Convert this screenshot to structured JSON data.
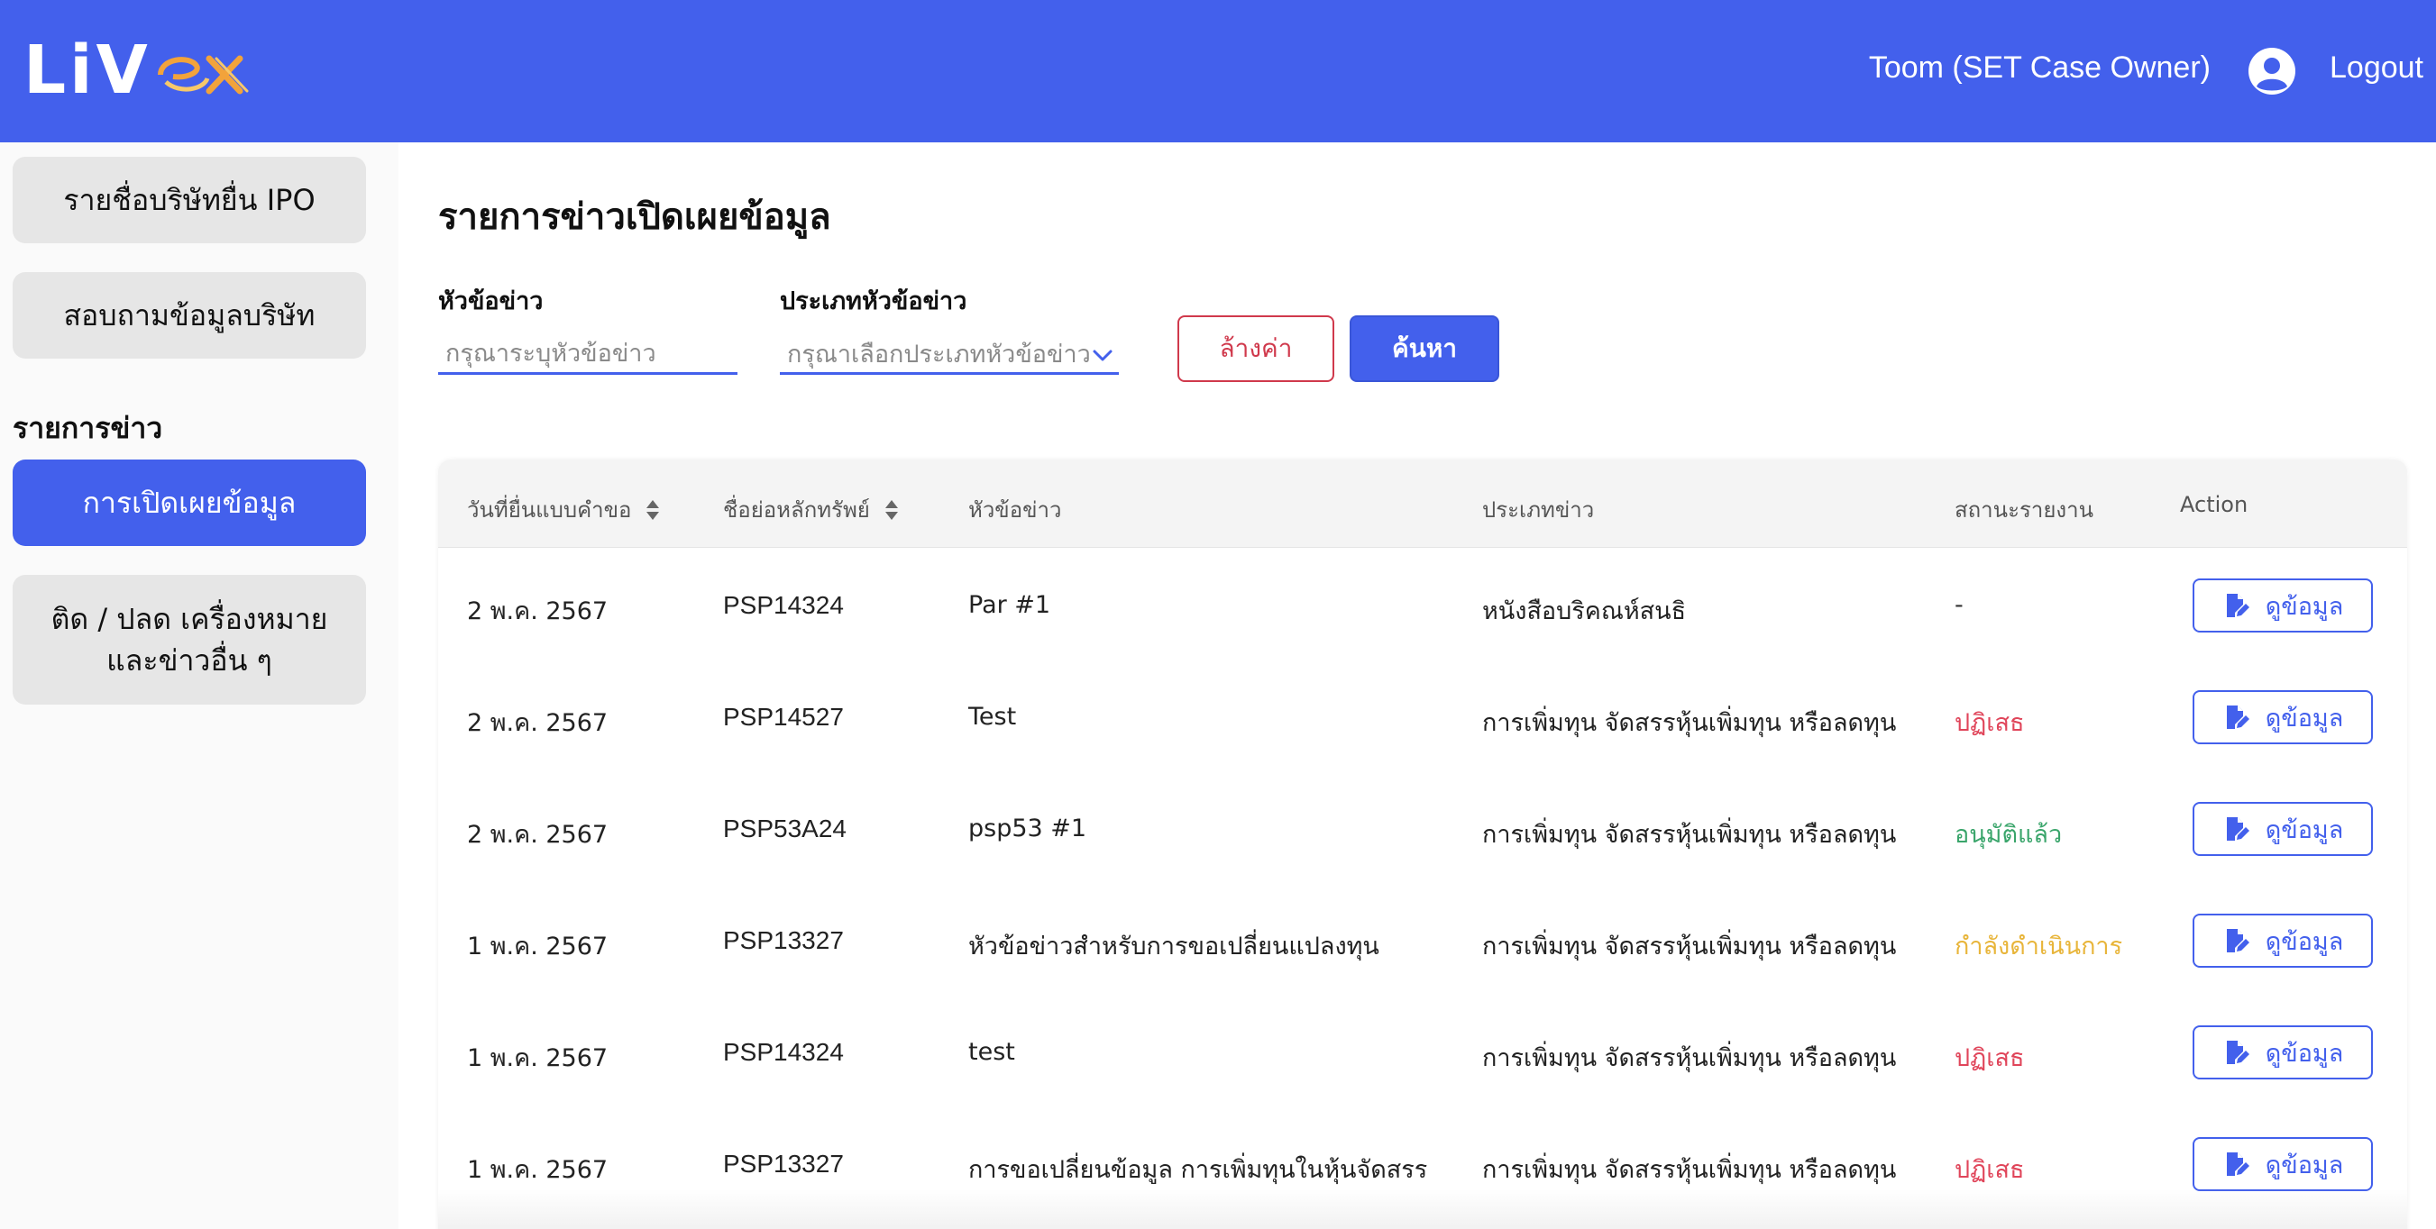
{
  "header": {
    "logo_text": "LiV",
    "user_name": "Toom (SET Case Owner)",
    "logout_label": "Logout",
    "brand_color": "#4360ec"
  },
  "sidebar": {
    "items": [
      {
        "label": "รายชื่อบริษัทยื่น IPO"
      },
      {
        "label": "สอบถามข้อมูลบริษัท"
      }
    ],
    "section_title": "รายการข่าว",
    "section_items": [
      {
        "label": "การเปิดเผยข้อมูล",
        "active": true
      },
      {
        "label": "ติด / ปลด เครื่องหมายและข่าวอื่น ๆ",
        "active": false
      }
    ]
  },
  "main": {
    "title": "รายการข่าวเปิดเผยข้อมูล",
    "filters": {
      "headline_label": "หัวข้อข่าว",
      "headline_placeholder": "กรุณาระบุหัวข้อข่าว",
      "type_label": "ประเภทหัวข้อข่าว",
      "type_placeholder": "กรุณาเลือกประเภทหัวข้อข่าว",
      "reset_label": "ล้างค่า",
      "search_label": "ค้นหา"
    },
    "table": {
      "columns": [
        "วันที่ยื่นแบบคำขอ",
        "ชื่อย่อหลักทรัพย์",
        "หัวข้อข่าว",
        "ประเภทข่าว",
        "สถานะรายงาน",
        "Action"
      ],
      "view_label": "ดูข้อมูล",
      "rows": [
        {
          "date": "2 พ.ค. 2567",
          "symbol": "PSP14324",
          "headline": "Par #1",
          "type": "หนังสือบริคณห์สนธิ",
          "status": "-",
          "status_color": "#333333"
        },
        {
          "date": "2 พ.ค. 2567",
          "symbol": "PSP14527",
          "headline": "Test",
          "type": "การเพิ่มทุน จัดสรรหุ้นเพิ่มทุน หรือลดทุน",
          "status": "ปฏิเสธ",
          "status_color": "#e0455a"
        },
        {
          "date": "2 พ.ค. 2567",
          "symbol": "PSP53A24",
          "headline": "psp53 #1",
          "type": "การเพิ่มทุน จัดสรรหุ้นเพิ่มทุน หรือลดทุน",
          "status": "อนุมัติแล้ว",
          "status_color": "#3aa56b"
        },
        {
          "date": "1 พ.ค. 2567",
          "symbol": "PSP13327",
          "headline": "หัวข้อข่าวสำหรับการขอเปลี่ยนแปลงทุน",
          "type": "การเพิ่มทุน จัดสรรหุ้นเพิ่มทุน หรือลดทุน",
          "status": "กำลังดำเนินการ",
          "status_color": "#e8b53a"
        },
        {
          "date": "1 พ.ค. 2567",
          "symbol": "PSP14324",
          "headline": "test",
          "type": "การเพิ่มทุน จัดสรรหุ้นเพิ่มทุน หรือลดทุน",
          "status": "ปฏิเสธ",
          "status_color": "#e0455a"
        },
        {
          "date": "1 พ.ค. 2567",
          "symbol": "PSP13327",
          "headline": "การขอเปลี่ยนข้อมูล การเพิ่มทุนในหุ้นจัดสรร",
          "type": "การเพิ่มทุน จัดสรรหุ้นเพิ่มทุน หรือลดทุน",
          "status": "ปฏิเสธ",
          "status_color": "#e0455a"
        }
      ]
    }
  }
}
